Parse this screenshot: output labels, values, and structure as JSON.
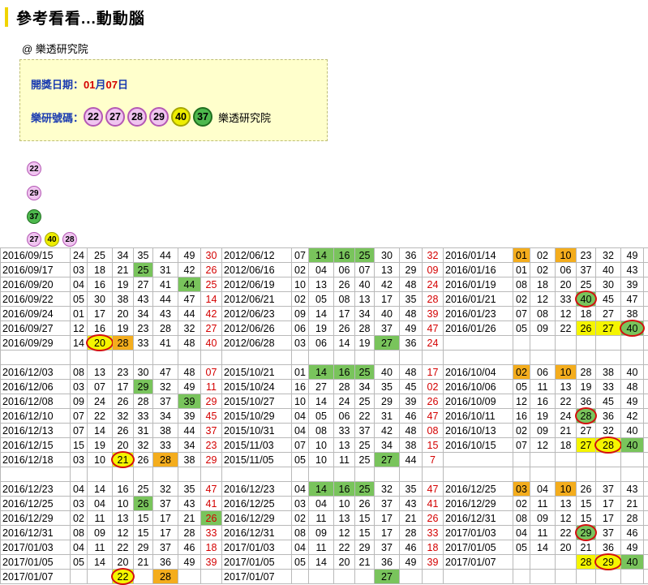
{
  "title": "參考看看...動動腦",
  "source": "@ 樂透研究院",
  "info": {
    "date_label": "開獎日期：",
    "month": "01",
    "month_unit": "月",
    "day": "07",
    "day_unit": "日",
    "numbers_label": "樂研號碼：",
    "brand": "樂透研究院",
    "balls": [
      {
        "n": "22",
        "color": "pink"
      },
      {
        "n": "27",
        "color": "pink"
      },
      {
        "n": "28",
        "color": "pink"
      },
      {
        "n": "29",
        "color": "pink"
      },
      {
        "n": "40",
        "color": "yellow"
      },
      {
        "n": "37",
        "color": "green"
      }
    ]
  },
  "groups": [
    [
      {
        "n": "22",
        "color": "pink"
      }
    ],
    [
      {
        "n": "29",
        "color": "pink"
      }
    ],
    [
      {
        "n": "37",
        "color": "green"
      }
    ],
    [
      {
        "n": "27",
        "color": "pink"
      },
      {
        "n": "40",
        "color": "yellow"
      },
      {
        "n": "28",
        "color": "pink"
      }
    ]
  ],
  "table": [
    [
      [
        "2016/09/15",
        "24",
        "25",
        "34",
        "35",
        "44",
        "49",
        "30"
      ],
      [
        "2012/06/12",
        "07",
        "14",
        "16",
        "25",
        "30",
        "36",
        "32"
      ],
      [
        "2016/01/14",
        "01",
        "02",
        "10",
        "23",
        "32",
        "49",
        "26"
      ]
    ],
    [
      [
        "2016/09/17",
        "03",
        "18",
        "21",
        "25",
        "31",
        "42",
        "26"
      ],
      [
        "2012/06/16",
        "02",
        "04",
        "06",
        "07",
        "13",
        "29",
        "09"
      ],
      [
        "2016/01/16",
        "01",
        "02",
        "06",
        "37",
        "40",
        "43",
        "24"
      ]
    ],
    [
      [
        "2016/09/20",
        "04",
        "16",
        "19",
        "27",
        "41",
        "44",
        "25"
      ],
      [
        "2012/06/19",
        "10",
        "13",
        "26",
        "40",
        "42",
        "48",
        "24"
      ],
      [
        "2016/01/19",
        "08",
        "18",
        "20",
        "25",
        "30",
        "39",
        "13"
      ]
    ],
    [
      [
        "2016/09/22",
        "05",
        "30",
        "38",
        "43",
        "44",
        "47",
        "14"
      ],
      [
        "2012/06/21",
        "02",
        "05",
        "08",
        "13",
        "17",
        "35",
        "28"
      ],
      [
        "2016/01/21",
        "02",
        "12",
        "33",
        "40",
        "45",
        "47",
        "09"
      ]
    ],
    [
      [
        "2016/09/24",
        "01",
        "17",
        "20",
        "34",
        "43",
        "44",
        "42"
      ],
      [
        "2012/06/23",
        "09",
        "14",
        "17",
        "34",
        "40",
        "48",
        "39"
      ],
      [
        "2016/01/23",
        "07",
        "08",
        "12",
        "18",
        "27",
        "38",
        "16"
      ]
    ],
    [
      [
        "2016/09/27",
        "12",
        "16",
        "19",
        "23",
        "28",
        "32",
        "27"
      ],
      [
        "2012/06/26",
        "06",
        "19",
        "26",
        "28",
        "37",
        "49",
        "47"
      ],
      [
        "2016/01/26",
        "05",
        "09",
        "22",
        "26",
        "27",
        "40",
        "13"
      ]
    ],
    [
      [
        "2016/09/29",
        "14",
        "20",
        "28",
        "33",
        "41",
        "48",
        "40"
      ],
      [
        "2012/06/28",
        "03",
        "06",
        "14",
        "19",
        "27",
        "36",
        "24"
      ],
      [
        "",
        "",
        "",
        "",
        "",
        "",
        "",
        ""
      ]
    ],
    [
      [
        "",
        "",
        "",
        "",
        "",
        "",
        "",
        ""
      ],
      [
        "",
        "",
        "",
        "",
        "",
        "",
        "",
        ""
      ],
      [
        "",
        "",
        "",
        "",
        "",
        "",
        "",
        ""
      ]
    ],
    [
      [
        "2016/12/03",
        "08",
        "13",
        "23",
        "30",
        "47",
        "48",
        "07"
      ],
      [
        "2015/10/21",
        "01",
        "14",
        "16",
        "25",
        "40",
        "48",
        "17"
      ],
      [
        "2016/10/04",
        "02",
        "06",
        "10",
        "28",
        "38",
        "40",
        "30"
      ]
    ],
    [
      [
        "2016/12/06",
        "03",
        "07",
        "17",
        "29",
        "32",
        "49",
        "11"
      ],
      [
        "2015/10/24",
        "16",
        "27",
        "28",
        "34",
        "35",
        "45",
        "02"
      ],
      [
        "2016/10/06",
        "05",
        "11",
        "13",
        "19",
        "33",
        "48",
        "34"
      ]
    ],
    [
      [
        "2016/12/08",
        "09",
        "24",
        "26",
        "28",
        "37",
        "39",
        "29"
      ],
      [
        "2015/10/27",
        "10",
        "14",
        "24",
        "25",
        "29",
        "39",
        "26"
      ],
      [
        "2016/10/09",
        "12",
        "16",
        "22",
        "36",
        "45",
        "49",
        "27"
      ]
    ],
    [
      [
        "2016/12/10",
        "07",
        "22",
        "32",
        "33",
        "34",
        "39",
        "45"
      ],
      [
        "2015/10/29",
        "04",
        "05",
        "06",
        "22",
        "31",
        "46",
        "47"
      ],
      [
        "2016/10/11",
        "16",
        "19",
        "24",
        "28",
        "36",
        "42",
        "13"
      ]
    ],
    [
      [
        "2016/12/13",
        "07",
        "14",
        "26",
        "31",
        "38",
        "44",
        "37"
      ],
      [
        "2015/10/31",
        "04",
        "08",
        "33",
        "37",
        "42",
        "48",
        "08"
      ],
      [
        "2016/10/13",
        "02",
        "09",
        "21",
        "27",
        "32",
        "40",
        "46"
      ]
    ],
    [
      [
        "2016/12/15",
        "15",
        "19",
        "20",
        "32",
        "33",
        "34",
        "23"
      ],
      [
        "2015/11/03",
        "07",
        "10",
        "13",
        "25",
        "34",
        "38",
        "15"
      ],
      [
        "2016/10/15",
        "07",
        "12",
        "18",
        "27",
        "28",
        "40",
        "10"
      ]
    ],
    [
      [
        "2016/12/18",
        "03",
        "10",
        "21",
        "26",
        "28",
        "38",
        "29"
      ],
      [
        "2015/11/05",
        "05",
        "10",
        "11",
        "25",
        "27",
        "44",
        "7"
      ],
      [
        "",
        "",
        "",
        "",
        "",
        "",
        "",
        ""
      ]
    ],
    [
      [
        "",
        "",
        "",
        "",
        "",
        "",
        "",
        ""
      ],
      [
        "",
        "",
        "",
        "",
        "",
        "",
        "",
        ""
      ],
      [
        "",
        "",
        "",
        "",
        "",
        "",
        "",
        ""
      ]
    ],
    [
      [
        "2016/12/23",
        "04",
        "14",
        "16",
        "25",
        "32",
        "35",
        "47"
      ],
      [
        "2016/12/23",
        "04",
        "14",
        "16",
        "25",
        "32",
        "35",
        "47"
      ],
      [
        "2016/12/25",
        "03",
        "04",
        "10",
        "26",
        "37",
        "43",
        "41"
      ]
    ],
    [
      [
        "2016/12/25",
        "03",
        "04",
        "10",
        "26",
        "37",
        "43",
        "41"
      ],
      [
        "2016/12/25",
        "03",
        "04",
        "10",
        "26",
        "37",
        "43",
        "41"
      ],
      [
        "2016/12/29",
        "02",
        "11",
        "13",
        "15",
        "17",
        "21",
        "26"
      ]
    ],
    [
      [
        "2016/12/29",
        "02",
        "11",
        "13",
        "15",
        "17",
        "21",
        "26"
      ],
      [
        "2016/12/29",
        "02",
        "11",
        "13",
        "15",
        "17",
        "21",
        "26"
      ],
      [
        "2016/12/31",
        "08",
        "09",
        "12",
        "15",
        "17",
        "28",
        "33"
      ]
    ],
    [
      [
        "2016/12/31",
        "08",
        "09",
        "12",
        "15",
        "17",
        "28",
        "33"
      ],
      [
        "2016/12/31",
        "08",
        "09",
        "12",
        "15",
        "17",
        "28",
        "33"
      ],
      [
        "2017/01/03",
        "04",
        "11",
        "22",
        "29",
        "37",
        "46",
        "18"
      ]
    ],
    [
      [
        "2017/01/03",
        "04",
        "11",
        "22",
        "29",
        "37",
        "46",
        "18"
      ],
      [
        "2017/01/03",
        "04",
        "11",
        "22",
        "29",
        "37",
        "46",
        "18"
      ],
      [
        "2017/01/05",
        "05",
        "14",
        "20",
        "21",
        "36",
        "49",
        "39"
      ]
    ],
    [
      [
        "2017/01/05",
        "05",
        "14",
        "20",
        "21",
        "36",
        "49",
        "39"
      ],
      [
        "2017/01/05",
        "05",
        "14",
        "20",
        "21",
        "36",
        "49",
        "39"
      ],
      [
        "2017/01/07",
        "",
        "",
        "",
        "28",
        "29",
        "40",
        ""
      ]
    ],
    [
      [
        "2017/01/07",
        "",
        "",
        "22",
        "",
        "28",
        "",
        ""
      ],
      [
        "2017/01/07",
        "",
        "",
        "",
        "",
        "27",
        "",
        ""
      ],
      [
        "",
        "",
        "",
        "",
        "",
        "",
        "",
        ""
      ]
    ]
  ],
  "highlights": [
    {
      "r": 0,
      "g": 1,
      "c": 2,
      "t": "g"
    },
    {
      "r": 0,
      "g": 1,
      "c": 3,
      "t": "g"
    },
    {
      "r": 0,
      "g": 1,
      "c": 4,
      "t": "g"
    },
    {
      "r": 0,
      "g": 2,
      "c": 1,
      "t": "o"
    },
    {
      "r": 0,
      "g": 2,
      "c": 3,
      "t": "o"
    },
    {
      "r": 1,
      "g": 0,
      "c": 4,
      "t": "g"
    },
    {
      "r": 2,
      "g": 0,
      "c": 6,
      "t": "g"
    },
    {
      "r": 3,
      "g": 2,
      "c": 4,
      "t": "g",
      "circle": true
    },
    {
      "r": 5,
      "g": 2,
      "c": 4,
      "t": "y"
    },
    {
      "r": 5,
      "g": 2,
      "c": 5,
      "t": "y"
    },
    {
      "r": 5,
      "g": 2,
      "c": 6,
      "t": "g",
      "circle": true
    },
    {
      "r": 6,
      "g": 0,
      "c": 2,
      "t": "y",
      "circle": true
    },
    {
      "r": 6,
      "g": 0,
      "c": 3,
      "t": "o"
    },
    {
      "r": 6,
      "g": 1,
      "c": 5,
      "t": "g"
    },
    {
      "r": 8,
      "g": 1,
      "c": 2,
      "t": "g"
    },
    {
      "r": 8,
      "g": 1,
      "c": 3,
      "t": "g"
    },
    {
      "r": 8,
      "g": 1,
      "c": 4,
      "t": "g"
    },
    {
      "r": 8,
      "g": 2,
      "c": 1,
      "t": "o"
    },
    {
      "r": 8,
      "g": 2,
      "c": 3,
      "t": "o"
    },
    {
      "r": 9,
      "g": 0,
      "c": 4,
      "t": "g"
    },
    {
      "r": 10,
      "g": 0,
      "c": 6,
      "t": "g"
    },
    {
      "r": 11,
      "g": 2,
      "c": 4,
      "t": "g",
      "circle": true
    },
    {
      "r": 13,
      "g": 2,
      "c": 4,
      "t": "y"
    },
    {
      "r": 13,
      "g": 2,
      "c": 5,
      "t": "y",
      "circle": true
    },
    {
      "r": 13,
      "g": 2,
      "c": 6,
      "t": "g"
    },
    {
      "r": 14,
      "g": 0,
      "c": 3,
      "t": "y",
      "circle": true
    },
    {
      "r": 14,
      "g": 0,
      "c": 5,
      "t": "o"
    },
    {
      "r": 14,
      "g": 1,
      "c": 5,
      "t": "g"
    },
    {
      "r": 16,
      "g": 1,
      "c": 2,
      "t": "g"
    },
    {
      "r": 16,
      "g": 1,
      "c": 3,
      "t": "g"
    },
    {
      "r": 16,
      "g": 1,
      "c": 4,
      "t": "g"
    },
    {
      "r": 16,
      "g": 2,
      "c": 1,
      "t": "o"
    },
    {
      "r": 16,
      "g": 2,
      "c": 3,
      "t": "o"
    },
    {
      "r": 17,
      "g": 0,
      "c": 4,
      "t": "g"
    },
    {
      "r": 18,
      "g": 0,
      "c": 7,
      "t": "g"
    },
    {
      "r": 19,
      "g": 2,
      "c": 4,
      "t": "g",
      "circle": true
    },
    {
      "r": 21,
      "g": 2,
      "c": 4,
      "t": "y"
    },
    {
      "r": 21,
      "g": 2,
      "c": 5,
      "t": "y",
      "circle": true
    },
    {
      "r": 21,
      "g": 2,
      "c": 6,
      "t": "g"
    },
    {
      "r": 22,
      "g": 0,
      "c": 3,
      "t": "y",
      "circle": true
    },
    {
      "r": 22,
      "g": 0,
      "c": 5,
      "t": "o"
    },
    {
      "r": 22,
      "g": 1,
      "c": 5,
      "t": "g"
    }
  ]
}
